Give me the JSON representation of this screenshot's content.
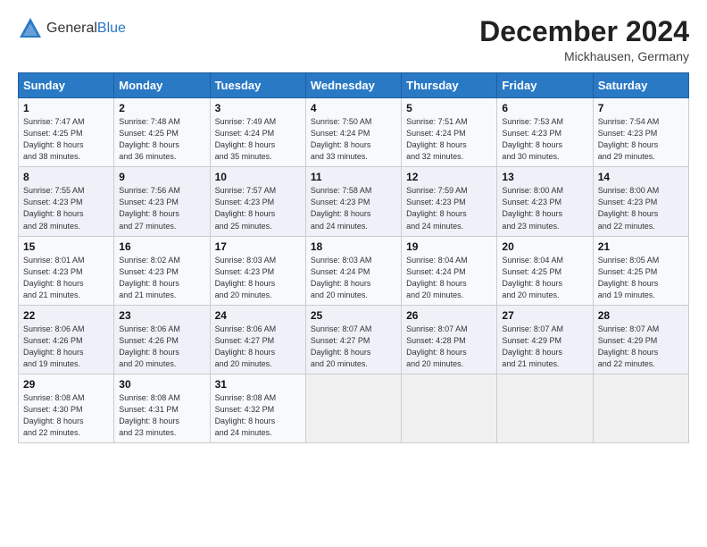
{
  "header": {
    "logo_general": "General",
    "logo_blue": "Blue",
    "month_title": "December 2024",
    "location": "Mickhausen, Germany"
  },
  "days_of_week": [
    "Sunday",
    "Monday",
    "Tuesday",
    "Wednesday",
    "Thursday",
    "Friday",
    "Saturday"
  ],
  "weeks": [
    [
      {
        "day": 1,
        "lines": [
          "Sunrise: 7:47 AM",
          "Sunset: 4:25 PM",
          "Daylight: 8 hours",
          "and 38 minutes."
        ]
      },
      {
        "day": 2,
        "lines": [
          "Sunrise: 7:48 AM",
          "Sunset: 4:25 PM",
          "Daylight: 8 hours",
          "and 36 minutes."
        ]
      },
      {
        "day": 3,
        "lines": [
          "Sunrise: 7:49 AM",
          "Sunset: 4:24 PM",
          "Daylight: 8 hours",
          "and 35 minutes."
        ]
      },
      {
        "day": 4,
        "lines": [
          "Sunrise: 7:50 AM",
          "Sunset: 4:24 PM",
          "Daylight: 8 hours",
          "and 33 minutes."
        ]
      },
      {
        "day": 5,
        "lines": [
          "Sunrise: 7:51 AM",
          "Sunset: 4:24 PM",
          "Daylight: 8 hours",
          "and 32 minutes."
        ]
      },
      {
        "day": 6,
        "lines": [
          "Sunrise: 7:53 AM",
          "Sunset: 4:23 PM",
          "Daylight: 8 hours",
          "and 30 minutes."
        ]
      },
      {
        "day": 7,
        "lines": [
          "Sunrise: 7:54 AM",
          "Sunset: 4:23 PM",
          "Daylight: 8 hours",
          "and 29 minutes."
        ]
      }
    ],
    [
      {
        "day": 8,
        "lines": [
          "Sunrise: 7:55 AM",
          "Sunset: 4:23 PM",
          "Daylight: 8 hours",
          "and 28 minutes."
        ]
      },
      {
        "day": 9,
        "lines": [
          "Sunrise: 7:56 AM",
          "Sunset: 4:23 PM",
          "Daylight: 8 hours",
          "and 27 minutes."
        ]
      },
      {
        "day": 10,
        "lines": [
          "Sunrise: 7:57 AM",
          "Sunset: 4:23 PM",
          "Daylight: 8 hours",
          "and 25 minutes."
        ]
      },
      {
        "day": 11,
        "lines": [
          "Sunrise: 7:58 AM",
          "Sunset: 4:23 PM",
          "Daylight: 8 hours",
          "and 24 minutes."
        ]
      },
      {
        "day": 12,
        "lines": [
          "Sunrise: 7:59 AM",
          "Sunset: 4:23 PM",
          "Daylight: 8 hours",
          "and 24 minutes."
        ]
      },
      {
        "day": 13,
        "lines": [
          "Sunrise: 8:00 AM",
          "Sunset: 4:23 PM",
          "Daylight: 8 hours",
          "and 23 minutes."
        ]
      },
      {
        "day": 14,
        "lines": [
          "Sunrise: 8:00 AM",
          "Sunset: 4:23 PM",
          "Daylight: 8 hours",
          "and 22 minutes."
        ]
      }
    ],
    [
      {
        "day": 15,
        "lines": [
          "Sunrise: 8:01 AM",
          "Sunset: 4:23 PM",
          "Daylight: 8 hours",
          "and 21 minutes."
        ]
      },
      {
        "day": 16,
        "lines": [
          "Sunrise: 8:02 AM",
          "Sunset: 4:23 PM",
          "Daylight: 8 hours",
          "and 21 minutes."
        ]
      },
      {
        "day": 17,
        "lines": [
          "Sunrise: 8:03 AM",
          "Sunset: 4:23 PM",
          "Daylight: 8 hours",
          "and 20 minutes."
        ]
      },
      {
        "day": 18,
        "lines": [
          "Sunrise: 8:03 AM",
          "Sunset: 4:24 PM",
          "Daylight: 8 hours",
          "and 20 minutes."
        ]
      },
      {
        "day": 19,
        "lines": [
          "Sunrise: 8:04 AM",
          "Sunset: 4:24 PM",
          "Daylight: 8 hours",
          "and 20 minutes."
        ]
      },
      {
        "day": 20,
        "lines": [
          "Sunrise: 8:04 AM",
          "Sunset: 4:25 PM",
          "Daylight: 8 hours",
          "and 20 minutes."
        ]
      },
      {
        "day": 21,
        "lines": [
          "Sunrise: 8:05 AM",
          "Sunset: 4:25 PM",
          "Daylight: 8 hours",
          "and 19 minutes."
        ]
      }
    ],
    [
      {
        "day": 22,
        "lines": [
          "Sunrise: 8:06 AM",
          "Sunset: 4:26 PM",
          "Daylight: 8 hours",
          "and 19 minutes."
        ]
      },
      {
        "day": 23,
        "lines": [
          "Sunrise: 8:06 AM",
          "Sunset: 4:26 PM",
          "Daylight: 8 hours",
          "and 20 minutes."
        ]
      },
      {
        "day": 24,
        "lines": [
          "Sunrise: 8:06 AM",
          "Sunset: 4:27 PM",
          "Daylight: 8 hours",
          "and 20 minutes."
        ]
      },
      {
        "day": 25,
        "lines": [
          "Sunrise: 8:07 AM",
          "Sunset: 4:27 PM",
          "Daylight: 8 hours",
          "and 20 minutes."
        ]
      },
      {
        "day": 26,
        "lines": [
          "Sunrise: 8:07 AM",
          "Sunset: 4:28 PM",
          "Daylight: 8 hours",
          "and 20 minutes."
        ]
      },
      {
        "day": 27,
        "lines": [
          "Sunrise: 8:07 AM",
          "Sunset: 4:29 PM",
          "Daylight: 8 hours",
          "and 21 minutes."
        ]
      },
      {
        "day": 28,
        "lines": [
          "Sunrise: 8:07 AM",
          "Sunset: 4:29 PM",
          "Daylight: 8 hours",
          "and 22 minutes."
        ]
      }
    ],
    [
      {
        "day": 29,
        "lines": [
          "Sunrise: 8:08 AM",
          "Sunset: 4:30 PM",
          "Daylight: 8 hours",
          "and 22 minutes."
        ]
      },
      {
        "day": 30,
        "lines": [
          "Sunrise: 8:08 AM",
          "Sunset: 4:31 PM",
          "Daylight: 8 hours",
          "and 23 minutes."
        ]
      },
      {
        "day": 31,
        "lines": [
          "Sunrise: 8:08 AM",
          "Sunset: 4:32 PM",
          "Daylight: 8 hours",
          "and 24 minutes."
        ]
      },
      null,
      null,
      null,
      null
    ]
  ]
}
